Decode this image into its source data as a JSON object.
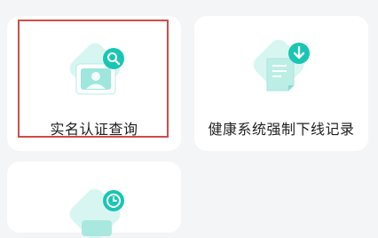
{
  "cards": [
    {
      "label": "实名认证查询",
      "icon": "id-card-search-icon",
      "selected": true
    },
    {
      "label": "健康系统强制下线记录",
      "icon": "document-download-icon",
      "selected": false
    },
    {
      "label": "",
      "icon": "clock-record-icon",
      "selected": false
    }
  ],
  "colors": {
    "accent": "#19c6b3",
    "accent_light": "#bff0e8",
    "highlight_border": "#d24b4b",
    "card_bg": "#ffffff",
    "page_bg": "#f4f5f7"
  }
}
